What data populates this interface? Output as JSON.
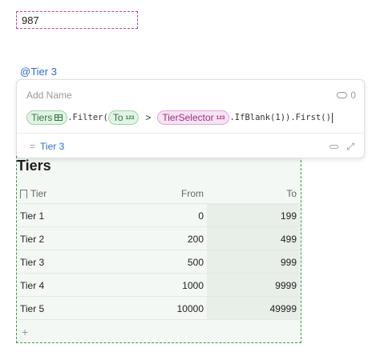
{
  "value_box": {
    "text": "987"
  },
  "reference": {
    "label": "@Tier 3"
  },
  "popup": {
    "name_placeholder": "Add Name",
    "ref_count": "0",
    "formula": {
      "table_chip": "Tiers",
      "method_filter": ".Filter(",
      "column_chip": "To",
      "column_chip_type": "123",
      "operator": ">",
      "control_chip": "TierSelector",
      "control_chip_type": "123",
      "tail": ".IfBlank(1)).First()"
    },
    "result": {
      "prefix": "=",
      "value": "Tier 3"
    }
  },
  "table": {
    "title": "Tiers",
    "columns": [
      "Tier",
      "From",
      "To"
    ],
    "rows": [
      [
        "Tier 1",
        "0",
        "199"
      ],
      [
        "Tier 2",
        "200",
        "499"
      ],
      [
        "Tier 3",
        "500",
        "999"
      ],
      [
        "Tier 4",
        "1000",
        "9999"
      ],
      [
        "Tier 5",
        "10000",
        "49999"
      ]
    ],
    "add_row": "+"
  },
  "colors": {
    "value_border": "#b43c9c",
    "table_border": "#2f9a43",
    "link": "#2e6bd1"
  }
}
